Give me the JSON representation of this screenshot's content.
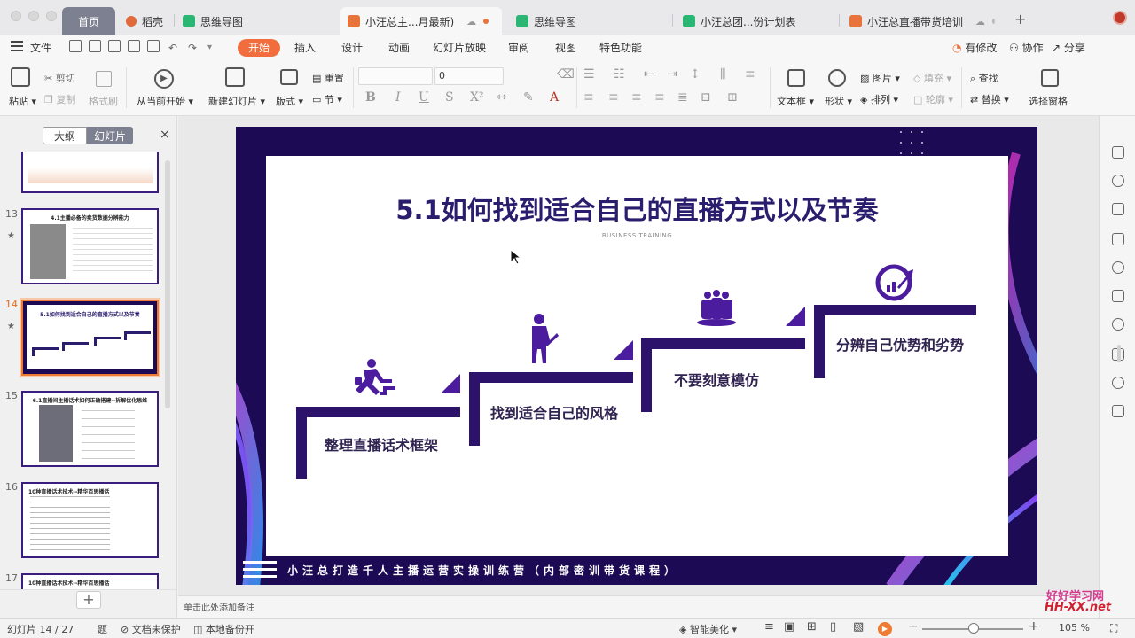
{
  "tabs": {
    "home": "首页",
    "t1": "稻壳",
    "t2": "思维导图",
    "t3": "小汪总主...月最新)",
    "t4": "思维导图",
    "t5": "小汪总团...份计划表",
    "t6": "小汪总直播带货培训",
    "new_tab": "+"
  },
  "menu": {
    "file": "文件",
    "items": [
      "开始",
      "插入",
      "设计",
      "动画",
      "幻灯片放映",
      "审阅",
      "视图",
      "特色功能"
    ],
    "right": [
      "有修改",
      "协作",
      "分享"
    ]
  },
  "ribbon": {
    "paste": "粘贴",
    "cut": "剪切",
    "copy": "复制",
    "format_painter": "格式刷",
    "play_from_current": "从当前开始",
    "new_slide": "新建幻灯片",
    "layout": "版式",
    "reset": "重置",
    "section": "节",
    "font_size": "0",
    "text_box": "文本框",
    "shape": "形状",
    "picture": "图片",
    "fill": "填充",
    "arrange": "排列",
    "outline": "轮廓",
    "find": "查找",
    "replace": "替换",
    "select_pane": "选择窗格"
  },
  "left_panel": {
    "outline_tab": "大纲",
    "slides_tab": "幻灯片",
    "close": "×",
    "thumbs": [
      {
        "num": "13",
        "title": "4.1主播必备的卖货数据分辨能力"
      },
      {
        "num": "14",
        "title": "5.1如何找到适合自己的直播方式以及节奏"
      },
      {
        "num": "15",
        "title": "6.1直播间主播话术如何正确搭建--拆解优化思维"
      },
      {
        "num": "16",
        "title": "10种直播话术技术--精华百思播话"
      },
      {
        "num": "17",
        "title": "10种直播话术技术--精华百思播话"
      }
    ],
    "add": "+"
  },
  "slide": {
    "title": "5.1如何找到适合自己的直播方式以及节奏",
    "subtitle": "BUSINESS TRAINING",
    "steps": [
      "整理直播话术框架",
      "找到适合自己的风格",
      "不要刻意模仿",
      "分辨自己优势和劣势"
    ],
    "footer": "小汪总打造千人主播运营实操训练营（内部密训带货课程）",
    "colors": {
      "bg": "#1c0a54",
      "accent": "#4b1d9e",
      "text": "#2f2350"
    }
  },
  "notes_placeholder": "单击此处添加备注",
  "status": {
    "slide_info": "幻灯片 14 / 27",
    "theme": "题",
    "doc_unprotected": "文档未保护",
    "local_backup": "本地备份开",
    "smart_beautify": "智能美化",
    "zoom": "105 %"
  },
  "watermark": {
    "line1": "好好学习网",
    "line2": "HH-XX.net"
  }
}
